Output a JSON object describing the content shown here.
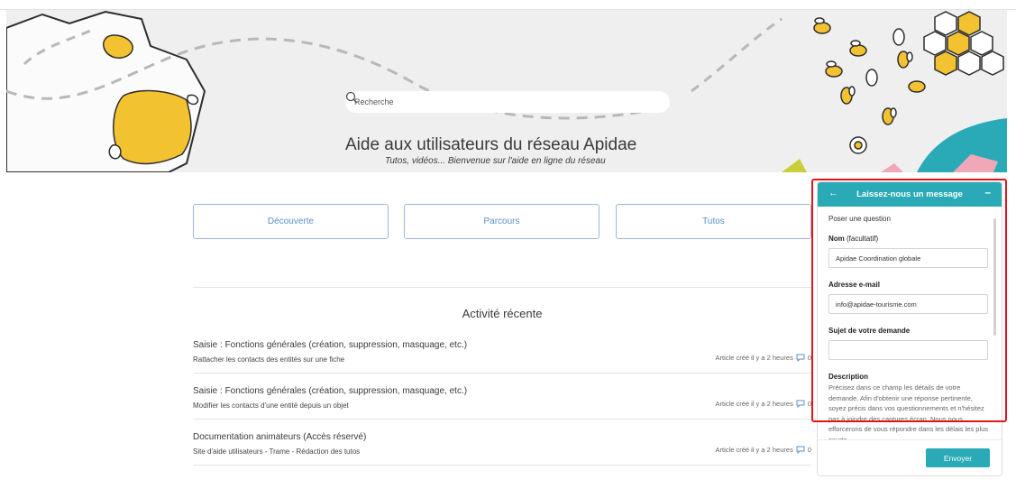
{
  "hero": {
    "search_placeholder": "Recherche",
    "title": "Aide aux utilisateurs du réseau Apidae",
    "subtitle": "Tutos, vidéos... Bienvenue sur l'aide en ligne du réseau"
  },
  "categories": [
    {
      "label": "Découverte"
    },
    {
      "label": "Parcours"
    },
    {
      "label": "Tutos"
    }
  ],
  "activity": {
    "title": "Activité récente",
    "items": [
      {
        "category": "Saisie : Fonctions générales (création, suppression, masquage, etc.)",
        "article": "Rattacher les contacts des entités sur une fiche",
        "meta": "Article créé il y a 2 heures",
        "comments": "0"
      },
      {
        "category": "Saisie : Fonctions générales (création, suppression, masquage, etc.)",
        "article": "Modifier les contacts d'une entité depuis un objet",
        "meta": "Article créé il y a 2 heures",
        "comments": "0"
      },
      {
        "category": "Documentation animateurs (Accès réservé)",
        "article": "Site d'aide utilisateurs - Trame - Rédaction des tutos",
        "meta": "Article créé il y a 2 heures",
        "comments": "0"
      }
    ]
  },
  "widget": {
    "title": "Laissez-nous un message",
    "back_icon": "←",
    "minimize_icon": "–",
    "intro": "Poser une question",
    "name_label": "Nom",
    "name_optional": "(facultatif)",
    "name_value": "Apidae Coordination globale",
    "email_label": "Adresse e-mail",
    "email_value": "info@apidae-tourisme.com",
    "subject_label": "Sujet de votre demande",
    "subject_value": "",
    "description_label": "Description",
    "description_help": "Précisez dans ce champ les détails de votre demande. Afin d'obtenir une réponse pertinente, soyez précis dans vos questionnements et n'hésitez pas à joindre des captures écran. Nous nous efforcerons de vous répondre dans les délais les plus courts",
    "send_label": "Envoyer"
  },
  "colors": {
    "accent": "#2aaab6",
    "link": "#5b8fc4",
    "map_yellow": "#f2c230",
    "highlight": "#e0161b"
  }
}
